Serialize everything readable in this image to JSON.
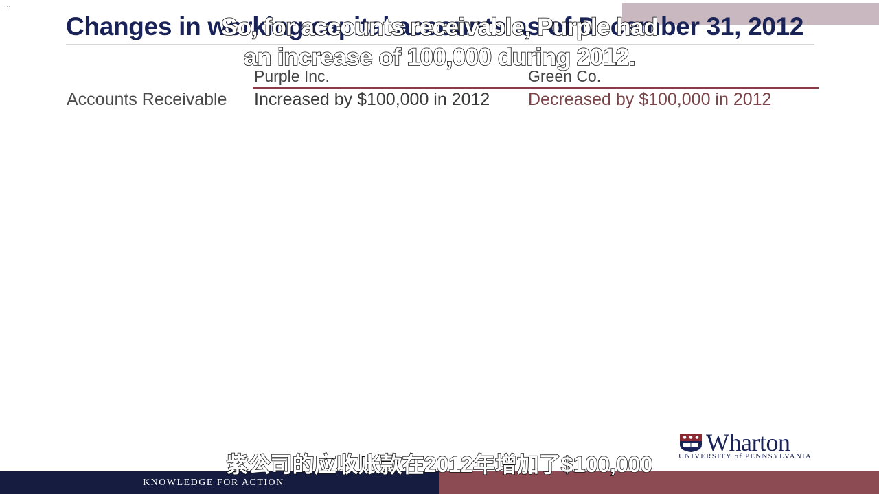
{
  "slide": {
    "title": "Changes in working capital accounts as of December 31, 2012",
    "corner_mark": "···"
  },
  "table": {
    "columns": [
      "Purple Inc.",
      "Green Co."
    ],
    "rows": [
      {
        "label": "Accounts Receivable",
        "values": [
          "Increased by $100,000 in 2012",
          "Decreased by $100,000 in 2012"
        ]
      }
    ]
  },
  "subtitles": {
    "english": [
      "So, for accounts receivable, Purple had",
      "an increase of 100,000 during 2012."
    ],
    "chinese": "紫公司的应收账款在2012年增加了$100,000"
  },
  "logo": {
    "name": "Wharton",
    "sub": "UNIVERSITY of PENNSYLVANIA"
  },
  "footer": {
    "tagline": "KNOWLEDGE FOR ACTION"
  },
  "colors": {
    "title": "#1a2357",
    "footer_left": "#151c3f",
    "footer_right": "#8c4a53",
    "header_rule": "#8a3b47"
  }
}
